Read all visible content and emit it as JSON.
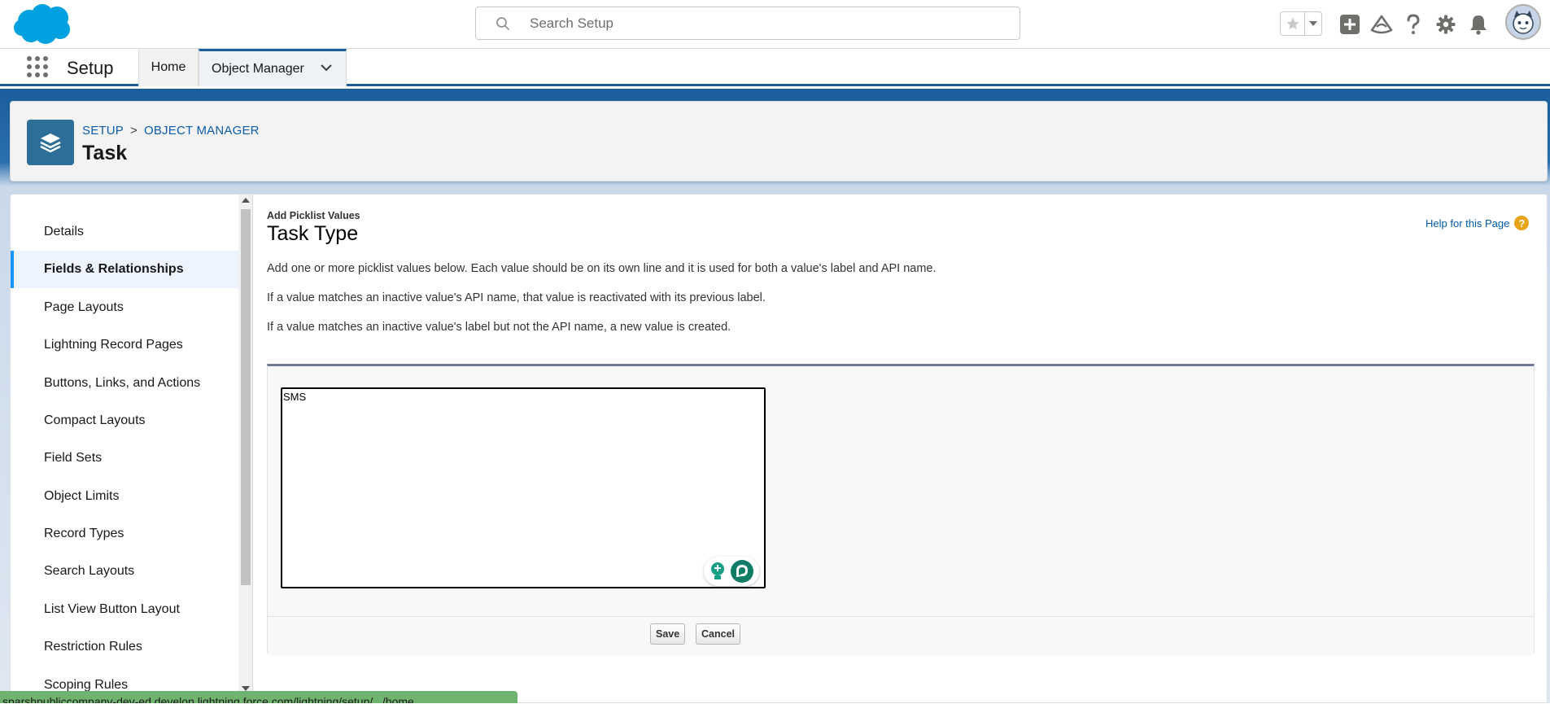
{
  "search": {
    "placeholder": "Search Setup"
  },
  "nav": {
    "app_name": "Setup",
    "tabs": [
      {
        "label": "Home"
      },
      {
        "label": "Object Manager"
      }
    ]
  },
  "page_header": {
    "breadcrumb": [
      "SETUP",
      "OBJECT MANAGER"
    ],
    "breadcrumb_separator": ">",
    "title": "Task"
  },
  "sidebar": {
    "items": [
      {
        "label": "Details"
      },
      {
        "label": "Fields & Relationships",
        "active": true
      },
      {
        "label": "Page Layouts"
      },
      {
        "label": "Lightning Record Pages"
      },
      {
        "label": "Buttons, Links, and Actions"
      },
      {
        "label": "Compact Layouts"
      },
      {
        "label": "Field Sets"
      },
      {
        "label": "Object Limits"
      },
      {
        "label": "Record Types"
      },
      {
        "label": "Search Layouts"
      },
      {
        "label": "List View Button Layout"
      },
      {
        "label": "Restriction Rules"
      },
      {
        "label": "Scoping Rules"
      }
    ]
  },
  "content": {
    "section_label": "Add Picklist Values",
    "title": "Task Type",
    "help_link": "Help for this Page",
    "help_icon": "?",
    "paragraphs": [
      "Add one or more picklist values below. Each value should be on its own line and it is used for both a value's label and API name.",
      "If a value matches an inactive value's API name, that value is reactivated with its previous label.",
      "If a value matches an inactive value's label but not the API name, a new value is created."
    ],
    "textarea_value": "SMS",
    "save_label": "Save",
    "cancel_label": "Cancel"
  },
  "status_bar": {
    "url": "sparshpubliccompany-dev-ed.develop.lightning.force.com/lightning/setup/.../home"
  },
  "colors": {
    "brand_blue": "#1b5e9c",
    "salesforce_cloud": "#00a1e0",
    "object_icon": "#2e6f99",
    "active_indicator": "#1b96ff",
    "help_icon": "#e8a316"
  },
  "icons": [
    "salesforce-logo",
    "search-icon",
    "star-icon",
    "chevron-down-icon",
    "plus-icon",
    "trailhead-icon",
    "question-icon",
    "gear-icon",
    "bell-icon",
    "avatar",
    "app-launcher-icon",
    "layers-icon",
    "help-icon",
    "grammar-icon"
  ]
}
